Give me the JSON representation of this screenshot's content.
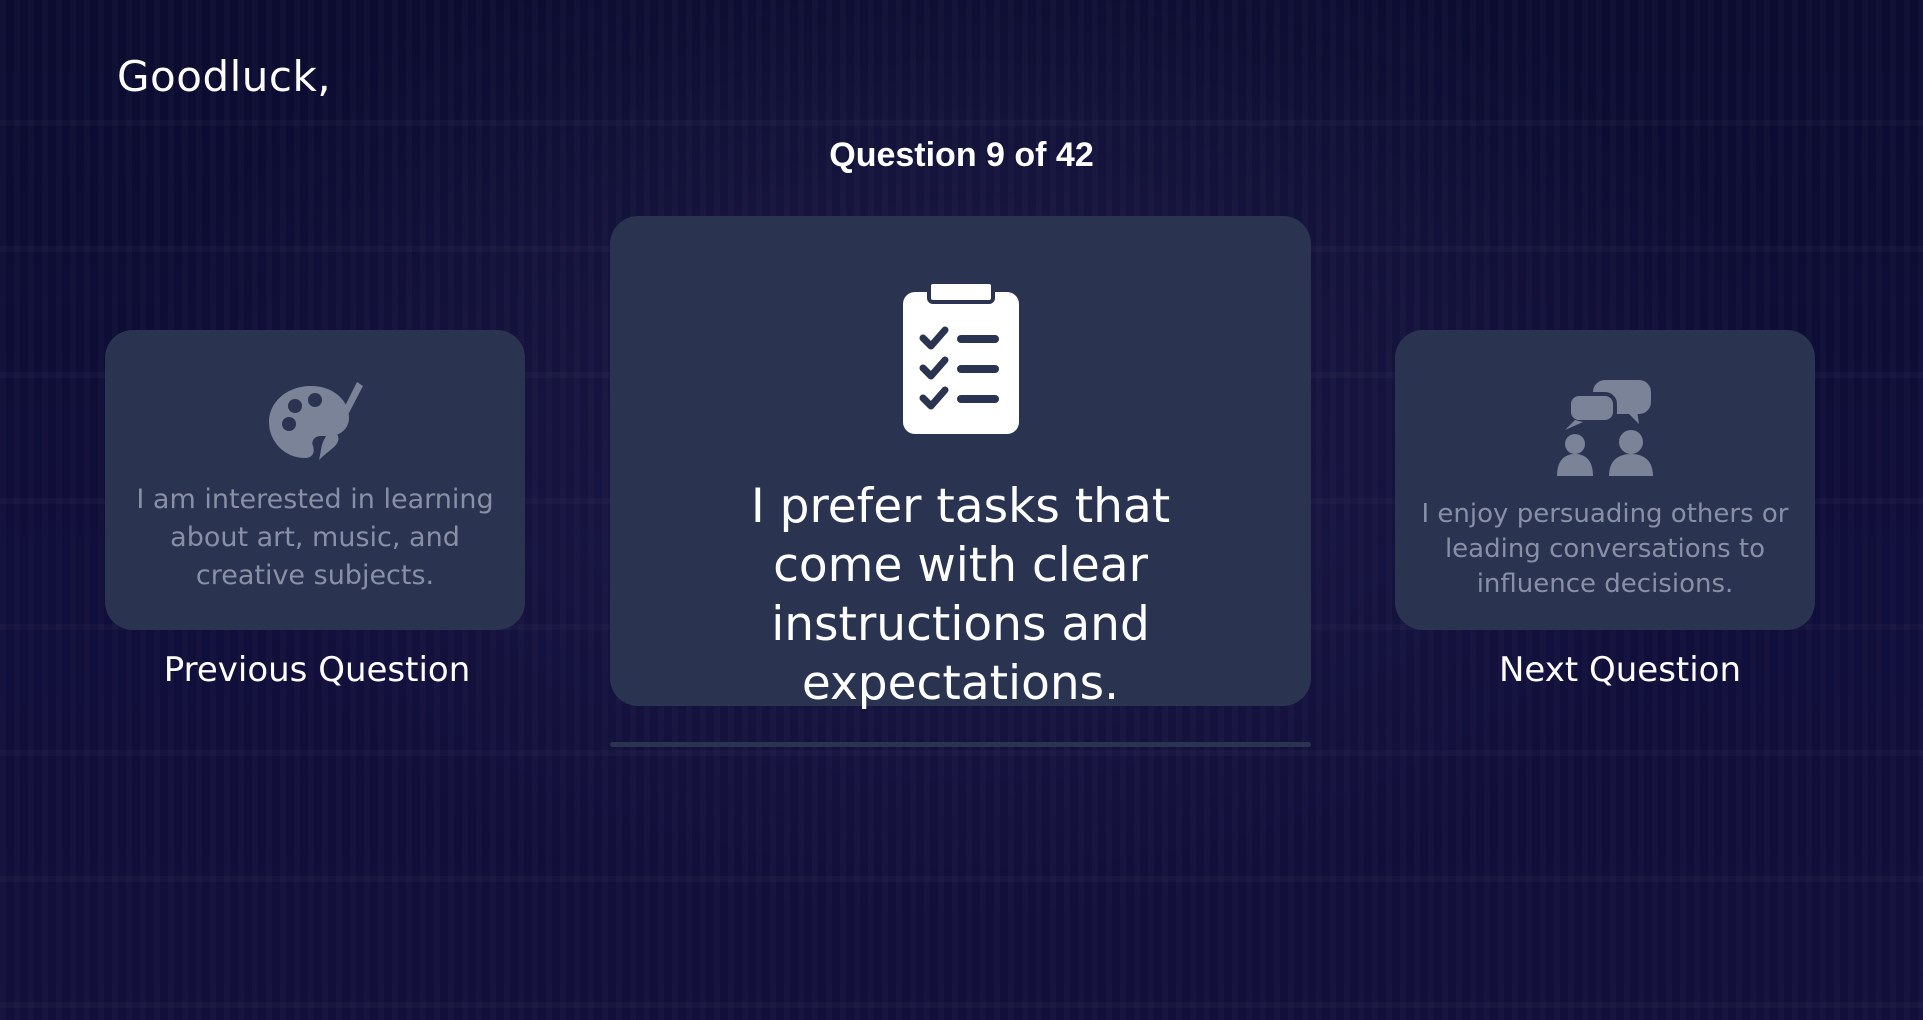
{
  "greeting": "Goodluck,",
  "counter": "Question 9 of 42",
  "previous": {
    "icon": "palette-brush-icon",
    "text": "I am interested in learning about art, music, and creative subjects.",
    "label": "Previous Question"
  },
  "current": {
    "icon": "clipboard-checklist-icon",
    "text": "I prefer tasks that come with clear instructions and expectations."
  },
  "next": {
    "icon": "people-chat-icon",
    "text": "I enjoy persuading others or leading conversations to influence decisions.",
    "label": "Next Question"
  },
  "progress": {
    "current": 9,
    "total": 42
  },
  "colors": {
    "background": "#0b0c30",
    "card": "#2a3350",
    "muted_text": "#8890a6",
    "text": "#ffffff"
  }
}
